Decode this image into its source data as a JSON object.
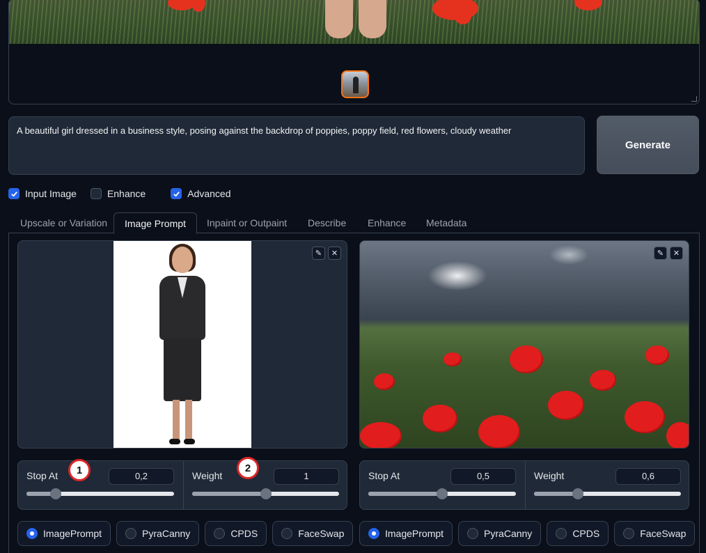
{
  "prompt": {
    "text": "A beautiful girl dressed in a business style, posing against the backdrop of poppies, poppy field, red flowers, cloudy weather"
  },
  "generate_label": "Generate",
  "options": [
    {
      "label": "Input Image",
      "checked": true
    },
    {
      "label": "Enhance",
      "checked": false
    },
    {
      "label": "Advanced",
      "checked": true
    }
  ],
  "tabs": [
    {
      "label": "Upscale or Variation",
      "active": false
    },
    {
      "label": "Image Prompt",
      "active": true
    },
    {
      "label": "Inpaint or Outpaint",
      "active": false
    },
    {
      "label": "Describe",
      "active": false
    },
    {
      "label": "Enhance",
      "active": false
    },
    {
      "label": "Metadata",
      "active": false
    }
  ],
  "image_prompt_1": {
    "stop_at_label": "Stop At",
    "stop_at_value": "0,2",
    "stop_at_fraction": 0.2,
    "weight_label": "Weight",
    "weight_value": "1",
    "weight_fraction": 0.5,
    "types": [
      "ImagePrompt",
      "PyraCanny",
      "CPDS",
      "FaceSwap"
    ],
    "selected_type": "ImagePrompt"
  },
  "image_prompt_2": {
    "stop_at_label": "Stop At",
    "stop_at_value": "0,5",
    "stop_at_fraction": 0.5,
    "weight_label": "Weight",
    "weight_value": "0,6",
    "weight_fraction": 0.3,
    "types": [
      "ImagePrompt",
      "PyraCanny",
      "CPDS",
      "FaceSwap"
    ],
    "selected_type": "ImagePrompt"
  },
  "markers": [
    "1",
    "2"
  ],
  "icons": {
    "edit": "pencil-icon",
    "close": "close-icon",
    "check": "checkmark-icon"
  },
  "colors": {
    "accent": "#2563eb",
    "marker_border": "#dc2626",
    "thumb_border": "#f97316",
    "background": "#0b0f19"
  }
}
